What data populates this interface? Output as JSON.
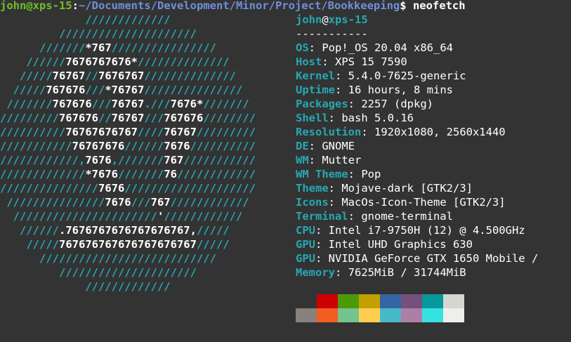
{
  "prompt": {
    "user_host": "john@xps-15",
    "sep": ":",
    "path": "~/Documents/Development/Minor/Project/Bookkeeping",
    "symbol": "$",
    "command": " neofetch"
  },
  "logo": [
    [
      [
        "c",
        "             /////////////"
      ]
    ],
    [
      [
        "c",
        "         /////////////////////"
      ]
    ],
    [
      [
        "c",
        "      ///////"
      ],
      [
        "w",
        "*767"
      ],
      [
        "c",
        "////////////////"
      ]
    ],
    [
      [
        "c",
        "    //////"
      ],
      [
        "w",
        "7676767676*"
      ],
      [
        "c",
        "//////////////"
      ]
    ],
    [
      [
        "c",
        "   /////"
      ],
      [
        "w",
        "76767"
      ],
      [
        "c",
        "//"
      ],
      [
        "w",
        "7676767"
      ],
      [
        "c",
        "//////////////"
      ]
    ],
    [
      [
        "c",
        "  /////"
      ],
      [
        "w",
        "767676"
      ],
      [
        "c",
        "///"
      ],
      [
        "w",
        "*76767"
      ],
      [
        "c",
        "///////////////"
      ]
    ],
    [
      [
        "c",
        " ///////"
      ],
      [
        "w",
        "767676"
      ],
      [
        "c",
        "///"
      ],
      [
        "w",
        "76767"
      ],
      [
        "c",
        ".///"
      ],
      [
        "w",
        "7676*"
      ],
      [
        "c",
        "///////"
      ]
    ],
    [
      [
        "c",
        "/////////"
      ],
      [
        "w",
        "767676"
      ],
      [
        "c",
        "//"
      ],
      [
        "w",
        "76767"
      ],
      [
        "c",
        "///"
      ],
      [
        "w",
        "767676"
      ],
      [
        "c",
        "////////"
      ]
    ],
    [
      [
        "c",
        "//////////"
      ],
      [
        "w",
        "76767676767"
      ],
      [
        "c",
        "////"
      ],
      [
        "w",
        "76767"
      ],
      [
        "c",
        "/////////"
      ]
    ],
    [
      [
        "c",
        "///////////"
      ],
      [
        "w",
        "76767676"
      ],
      [
        "c",
        "//////"
      ],
      [
        "w",
        "7676"
      ],
      [
        "c",
        "//////////"
      ]
    ],
    [
      [
        "c",
        "////////////,"
      ],
      [
        "w",
        "7676"
      ],
      [
        "c",
        ",///////"
      ],
      [
        "w",
        "767"
      ],
      [
        "c",
        "///////////"
      ]
    ],
    [
      [
        "c",
        "/////////////"
      ],
      [
        "w",
        "*7676"
      ],
      [
        "c",
        "///////"
      ],
      [
        "w",
        "76"
      ],
      [
        "c",
        "////////////"
      ]
    ],
    [
      [
        "c",
        "///////////////"
      ],
      [
        "w",
        "7676"
      ],
      [
        "c",
        "////////////////////"
      ]
    ],
    [
      [
        "c",
        " ///////////////"
      ],
      [
        "w",
        "7676"
      ],
      [
        "c",
        "///"
      ],
      [
        "w",
        "767"
      ],
      [
        "c",
        "////////////"
      ]
    ],
    [
      [
        "c",
        "  //////////////////////"
      ],
      [
        "w",
        "'"
      ],
      [
        "c",
        "////////////"
      ]
    ],
    [
      [
        "c",
        "   //////"
      ],
      [
        "w",
        ".7676767676767676767,"
      ],
      [
        "c",
        "/////"
      ]
    ],
    [
      [
        "c",
        "    /////"
      ],
      [
        "w",
        "767676767676767676767"
      ],
      [
        "c",
        "/////"
      ]
    ],
    [
      [
        "c",
        "      ///////////////////////////"
      ]
    ],
    [
      [
        "c",
        "         /////////////////////"
      ]
    ],
    [
      [
        "c",
        "             /////////////"
      ]
    ]
  ],
  "info": {
    "header": {
      "user": "john",
      "at": "@",
      "host": "xps-15"
    },
    "separator": "-----------",
    "fields": [
      {
        "key": "OS",
        "value": "Pop!_OS 20.04 x86_64"
      },
      {
        "key": "Host",
        "value": "XPS 15 7590"
      },
      {
        "key": "Kernel",
        "value": "5.4.0-7625-generic"
      },
      {
        "key": "Uptime",
        "value": "16 hours, 8 mins"
      },
      {
        "key": "Packages",
        "value": "2257 (dpkg)"
      },
      {
        "key": "Shell",
        "value": "bash 5.0.16"
      },
      {
        "key": "Resolution",
        "value": "1920x1080, 2560x1440"
      },
      {
        "key": "DE",
        "value": "GNOME"
      },
      {
        "key": "WM",
        "value": "Mutter"
      },
      {
        "key": "WM Theme",
        "value": "Pop"
      },
      {
        "key": "Theme",
        "value": "Mojave-dark [GTK2/3]"
      },
      {
        "key": "Icons",
        "value": "MacOs-Icon-Theme [GTK2/3]"
      },
      {
        "key": "Terminal",
        "value": "gnome-terminal"
      },
      {
        "key": "CPU",
        "value": "Intel i7-9750H (12) @ 4.500GHz"
      },
      {
        "key": "GPU",
        "value": "Intel UHD Graphics 630"
      },
      {
        "key": "GPU",
        "value": "NVIDIA GeForce GTX 1650 Mobile /"
      },
      {
        "key": "Memory",
        "value": "7625MiB / 31744MiB"
      }
    ]
  },
  "palette": {
    "top": [
      "#333333",
      "#cc0000",
      "#4e9a06",
      "#c4a000",
      "#3465a4",
      "#75507b",
      "#06989a",
      "#d3d7cf"
    ],
    "bottom": [
      "#88807c",
      "#f15d22",
      "#73c48f",
      "#ffce51",
      "#48b9c7",
      "#ad7fa8",
      "#34e2e2",
      "#eeeeec"
    ]
  },
  "colors": {
    "background": "#333333",
    "accent": "#27a8b3",
    "user": "#6fbf26",
    "path": "#6f8fd8"
  }
}
